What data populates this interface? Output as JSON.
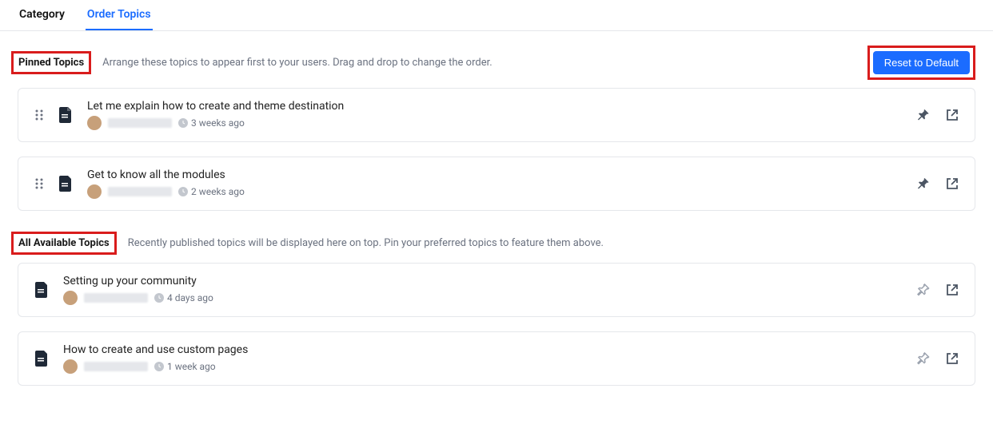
{
  "tabs": {
    "category": "Category",
    "order_topics": "Order Topics"
  },
  "pinned_section": {
    "label": "Pinned Topics",
    "description": "Arrange these topics to appear first to your users. Drag and drop to change the order.",
    "reset_btn": "Reset to Default"
  },
  "pinned_topics": [
    {
      "title": "Let me explain how to create and theme destination",
      "time": "3 weeks ago"
    },
    {
      "title": "Get to know all the modules",
      "time": "2 weeks ago"
    }
  ],
  "available_section": {
    "label": "All Available Topics",
    "description": "Recently published topics will be displayed here on top. Pin your preferred topics to feature them above."
  },
  "available_topics": [
    {
      "title": "Setting up your community",
      "time": "4 days ago"
    },
    {
      "title": "How to create and use custom pages",
      "time": "1 week ago"
    }
  ]
}
